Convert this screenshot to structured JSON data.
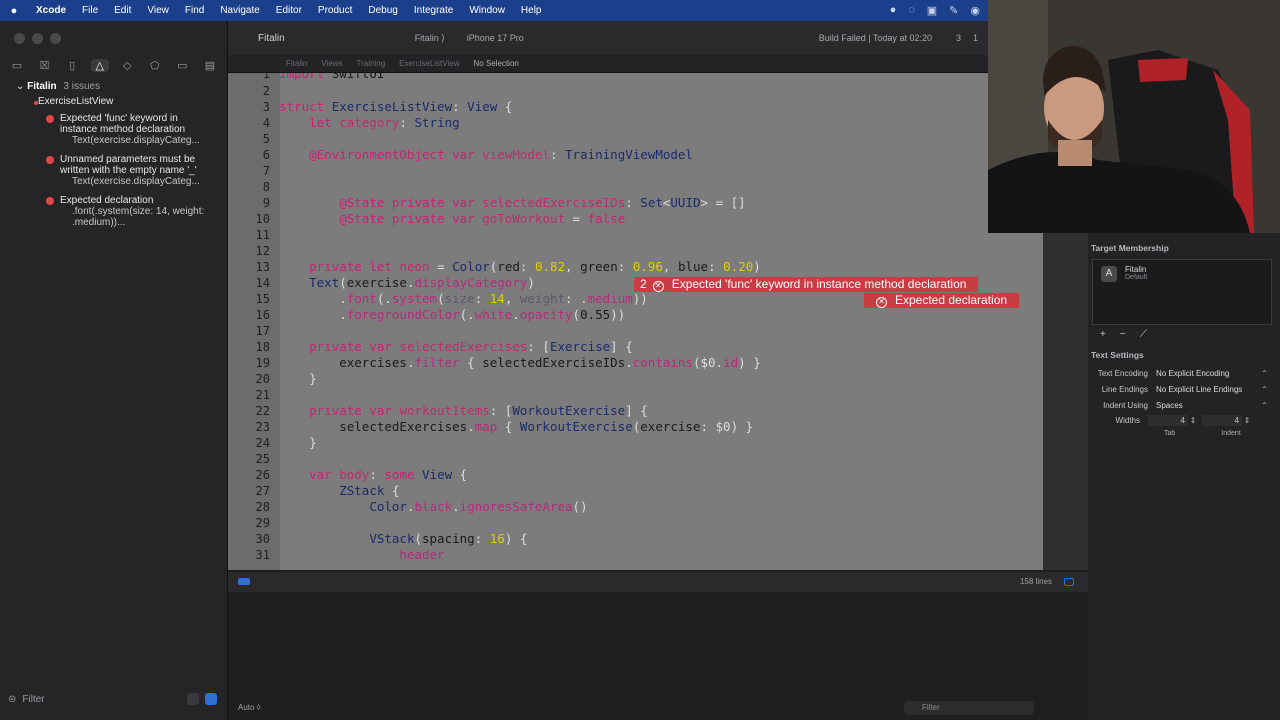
{
  "menubar": {
    "apple": "",
    "items": [
      "Xcode",
      "File",
      "Edit",
      "View",
      "Find",
      "Navigate",
      "Editor",
      "Product",
      "Debug",
      "Integrate",
      "Window",
      "Help"
    ],
    "status_icons": [
      "●",
      "◌",
      "▣",
      "✎",
      "◉"
    ]
  },
  "toolbar": {
    "project": "Fitalin",
    "scheme": "Fitalin ⟩",
    "device": "iPhone 17 Pro",
    "build_status": "Build Failed | Today at 02:20",
    "errors_count": "3",
    "warnings_count": "1"
  },
  "jumpbar": {
    "crumbs": [
      "Fitalin",
      "Views",
      "Training",
      "ExerciseListView"
    ],
    "selection": "No Selection"
  },
  "navigator": {
    "tab_icons": [
      "▭",
      "☒",
      "▯",
      "△",
      "◇",
      "⬠",
      "▭",
      "▤"
    ],
    "root_name": "Fitalin",
    "root_count": "3 issues",
    "file_name": "ExerciseListView",
    "issues": [
      {
        "title": "Expected 'func' keyword in instance method declaration",
        "detail": "Text(exercise.displayCateg..."
      },
      {
        "title": "Unnamed parameters must be written with the empty name '_'",
        "detail": "Text(exercise.displayCateg..."
      },
      {
        "title": "Expected declaration",
        "detail": ".font(.system(size: 14, weight: .medium))..."
      }
    ],
    "filter_placeholder": "Filter"
  },
  "editor": {
    "lines_label": "158 lines",
    "errors": [
      {
        "count": "2",
        "message": "Expected 'func' keyword in instance method declaration"
      },
      {
        "count": "",
        "message": "Expected declaration"
      }
    ]
  },
  "debug": {
    "auto_label": "Auto ◊",
    "filter_placeholder": "Filter"
  },
  "inspector": {
    "target_membership_title": "Target Membership",
    "target_name": "Fitalin",
    "target_sub": "Default",
    "add": "+",
    "remove": "−",
    "edit": "⟋",
    "text_settings_title": "Text Settings",
    "encoding_label": "Text Encoding",
    "encoding_value": "No Explicit Encoding",
    "line_endings_label": "Line Endings",
    "line_endings_value": "No Explicit Line Endings",
    "indent_label": "Indent Using",
    "indent_value": "Spaces",
    "widths_label": "Widths",
    "tab_width": "4",
    "indent_width": "4",
    "tab_label": "Tab",
    "indent_sub_label": "Indent"
  },
  "colors": {
    "menubar_bg": "#1c3f8c",
    "editor_bg": "#7c7c7c",
    "error_red": "#c83c44",
    "keyword": "#d01e78",
    "number": "#e0d000"
  }
}
